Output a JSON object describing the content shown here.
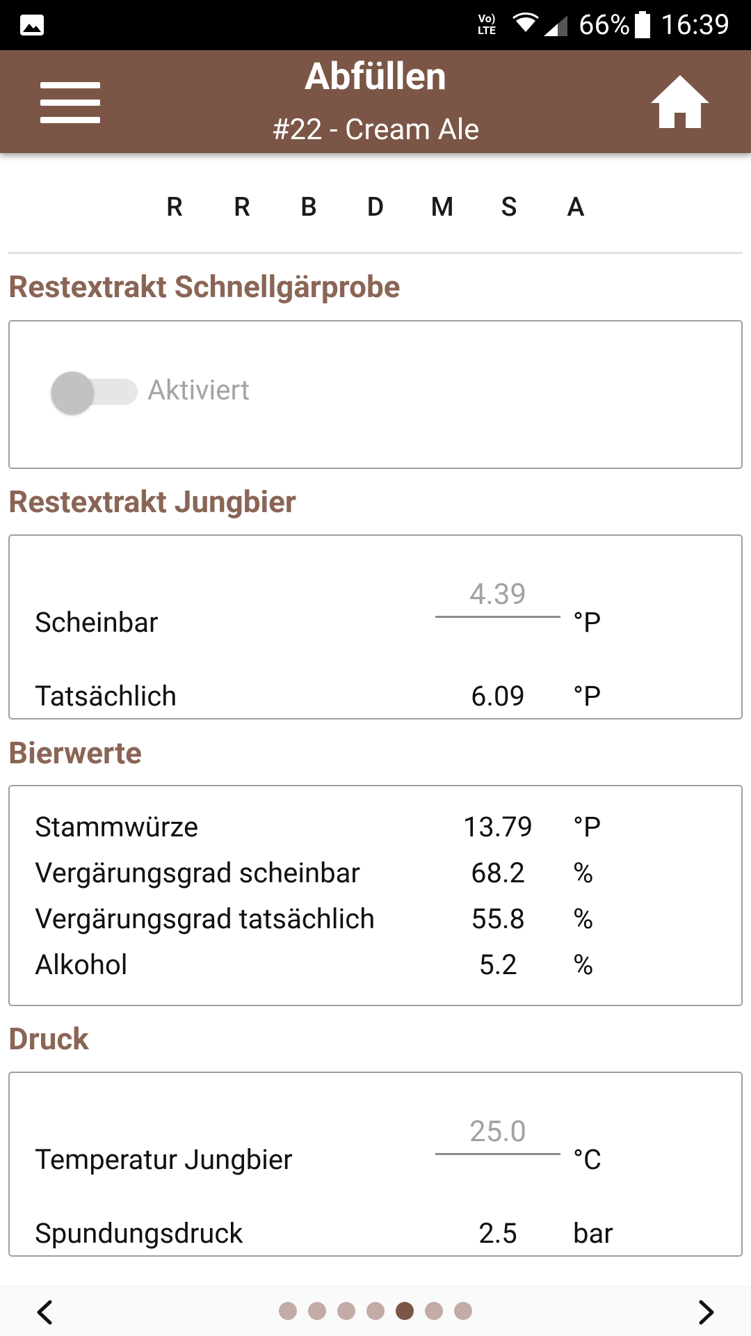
{
  "status_bar": {
    "network_label": "Vo) LTE",
    "battery_percent": "66%",
    "time": "16:39"
  },
  "header": {
    "title": "Abfüllen",
    "subtitle": "#22 - Cream Ale",
    "menu_icon": "hamburger-menu-icon",
    "home_icon": "home-icon"
  },
  "steps": [
    "R",
    "R",
    "B",
    "D",
    "M",
    "S",
    "A"
  ],
  "sections": {
    "schnellgaerprobe": {
      "title": "Restextrakt Schnellgärprobe",
      "toggle_label": "Aktiviert",
      "toggle_on": false
    },
    "jungbier": {
      "title": "Restextrakt Jungbier",
      "rows": [
        {
          "label": "Scheinbar",
          "value": "4.39",
          "unit": "°P"
        },
        {
          "label": "Tatsächlich",
          "value": "6.09",
          "unit": "°P"
        }
      ]
    },
    "bierwerte": {
      "title": "Bierwerte",
      "rows": [
        {
          "label": "Stammwürze",
          "value": "13.79",
          "unit": "°P"
        },
        {
          "label": "Vergärungsgrad scheinbar",
          "value": "68.2",
          "unit": "%"
        },
        {
          "label": "Vergärungsgrad tatsächlich",
          "value": "55.8",
          "unit": "%"
        },
        {
          "label": "Alkohol",
          "value": "5.2",
          "unit": "%"
        }
      ]
    },
    "druck": {
      "title": "Druck",
      "rows": [
        {
          "label": "Temperatur Jungbier",
          "value": "25.0",
          "unit": "°C"
        },
        {
          "label": "Spundungsdruck",
          "value": "2.5",
          "unit": "bar"
        }
      ]
    }
  },
  "pager": {
    "total_pages": 7,
    "active_page": 5
  },
  "colors": {
    "brand": "#7b5647",
    "section_title": "#8a6556",
    "dot_inactive": "#c3aca6"
  }
}
